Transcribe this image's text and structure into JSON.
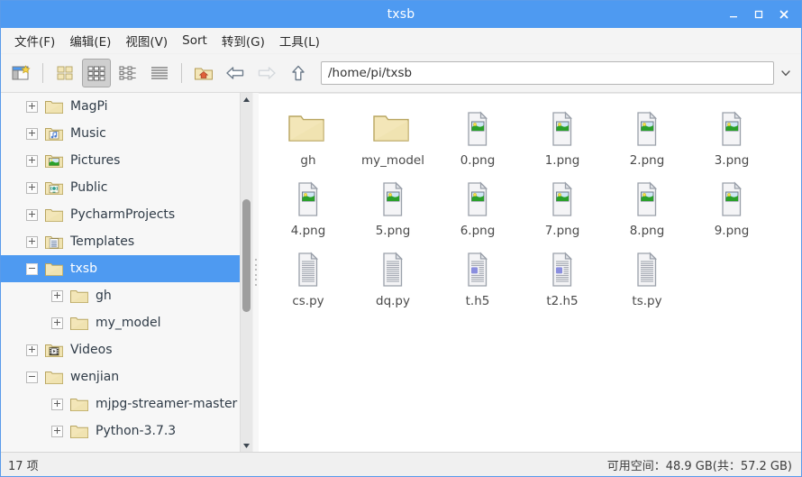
{
  "window": {
    "title": "txsb",
    "buttons": {
      "minimize": "minimize",
      "maximize": "maximize",
      "close": "close"
    }
  },
  "menubar": {
    "items": [
      {
        "label": "文件(F)"
      },
      {
        "label": "编辑(E)"
      },
      {
        "label": "视图(V)"
      },
      {
        "label": "Sort"
      },
      {
        "label": "转到(G)"
      },
      {
        "label": "工具(L)"
      }
    ]
  },
  "toolbar": {
    "buttons": [
      {
        "name": "new-tab-icon",
        "title": "New Tab"
      },
      {
        "name": "view-icons-large-icon",
        "title": "Large Icons"
      },
      {
        "name": "view-icons-grid-icon",
        "title": "Icon View"
      },
      {
        "name": "view-details-icon",
        "title": "Detailed List View"
      },
      {
        "name": "view-compact-icon",
        "title": "Compact View"
      },
      {
        "name": "home-folder-icon",
        "title": "Home"
      },
      {
        "name": "back-arrow-icon",
        "title": "Back"
      },
      {
        "name": "forward-arrow-icon",
        "title": "Forward"
      },
      {
        "name": "up-arrow-icon",
        "title": "Up"
      }
    ],
    "path": {
      "value": "/home/pi/txsb",
      "placeholder": "/home/pi/txsb"
    }
  },
  "sidebar": {
    "items": [
      {
        "label": "MagPi",
        "icon": "folder-icon",
        "indent": 1,
        "expander": "plus",
        "selected": false
      },
      {
        "label": "Music",
        "icon": "music-icon",
        "indent": 1,
        "expander": "plus",
        "selected": false
      },
      {
        "label": "Pictures",
        "icon": "pictures-icon",
        "indent": 1,
        "expander": "plus",
        "selected": false
      },
      {
        "label": "Public",
        "icon": "public-icon",
        "indent": 1,
        "expander": "plus",
        "selected": false
      },
      {
        "label": "PycharmProjects",
        "icon": "folder-icon",
        "indent": 1,
        "expander": "plus",
        "selected": false
      },
      {
        "label": "Templates",
        "icon": "templates-icon",
        "indent": 1,
        "expander": "plus",
        "selected": false
      },
      {
        "label": "txsb",
        "icon": "folder-icon",
        "indent": 1,
        "expander": "minus",
        "selected": true
      },
      {
        "label": "gh",
        "icon": "folder-icon",
        "indent": 2,
        "expander": "plus",
        "selected": false
      },
      {
        "label": "my_model",
        "icon": "folder-icon",
        "indent": 2,
        "expander": "plus",
        "selected": false
      },
      {
        "label": "Videos",
        "icon": "videos-icon",
        "indent": 1,
        "expander": "plus",
        "selected": false
      },
      {
        "label": "wenjian",
        "icon": "folder-icon",
        "indent": 1,
        "expander": "minus",
        "selected": false
      },
      {
        "label": "mjpg-streamer-master",
        "icon": "folder-icon",
        "indent": 2,
        "expander": "plus",
        "selected": false
      },
      {
        "label": "Python-3.7.3",
        "icon": "folder-icon",
        "indent": 2,
        "expander": "plus",
        "selected": false
      }
    ]
  },
  "files": {
    "items": [
      {
        "name": "gh",
        "type": "folder"
      },
      {
        "name": "my_model",
        "type": "folder"
      },
      {
        "name": "0.png",
        "type": "image"
      },
      {
        "name": "1.png",
        "type": "image"
      },
      {
        "name": "2.png",
        "type": "image"
      },
      {
        "name": "3.png",
        "type": "image"
      },
      {
        "name": "4.png",
        "type": "image"
      },
      {
        "name": "5.png",
        "type": "image"
      },
      {
        "name": "6.png",
        "type": "image"
      },
      {
        "name": "7.png",
        "type": "image"
      },
      {
        "name": "8.png",
        "type": "image"
      },
      {
        "name": "9.png",
        "type": "image"
      },
      {
        "name": "cs.py",
        "type": "text"
      },
      {
        "name": "dq.py",
        "type": "text"
      },
      {
        "name": "t.h5",
        "type": "data"
      },
      {
        "name": "t2.h5",
        "type": "data"
      },
      {
        "name": "ts.py",
        "type": "text"
      }
    ]
  },
  "statusbar": {
    "item_count": "17 项",
    "disk_info": "可用空间：48.9 GB(共：57.2 GB)"
  },
  "colors": {
    "titlebar": "#4e9af1",
    "selection": "#4e9af1",
    "folder": "#f3e6b8",
    "image_sky": "#cfe7f5",
    "image_hill": "#2aa02a",
    "image_sun": "#f6e04a",
    "data_block": "#8a8ede"
  }
}
